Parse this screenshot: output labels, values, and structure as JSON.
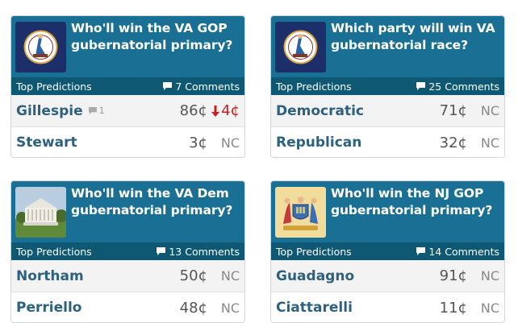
{
  "labels": {
    "top_predictions": "Top Predictions",
    "comments_suffix": "Comments"
  },
  "colors": {
    "header": "#1a7094",
    "subbar": "#0e5874",
    "candidate": "#2c6180",
    "down": "#d21b1b"
  },
  "cards": [
    {
      "title": "Who'll win the VA GOP gubernatorial primary?",
      "image": "virginia-flag-icon",
      "top_predictions": "Top Predictions",
      "comments": "7 Comments",
      "rows": [
        {
          "name": "Gillespie",
          "comment_count": "1",
          "price": "86¢",
          "change": "4¢",
          "direction": "down"
        },
        {
          "name": "Stewart",
          "price": "3¢",
          "change": "NC"
        }
      ]
    },
    {
      "title": "Which party will win VA gubernatorial race?",
      "image": "virginia-flag-icon",
      "top_predictions": "Top Predictions",
      "comments": "25 Comments",
      "rows": [
        {
          "name": "Democratic",
          "price": "71¢",
          "change": "NC"
        },
        {
          "name": "Republican",
          "price": "32¢",
          "change": "NC"
        }
      ]
    },
    {
      "title": "Who'll win the VA Dem gubernatorial primary?",
      "image": "capitol-building-photo",
      "top_predictions": "Top Predictions",
      "comments": "13 Comments",
      "rows": [
        {
          "name": "Northam",
          "price": "50¢",
          "change": "NC"
        },
        {
          "name": "Perriello",
          "price": "48¢",
          "change": "NC"
        }
      ]
    },
    {
      "title": "Who'll win the NJ GOP gubernatorial primary?",
      "image": "new-jersey-seal-icon",
      "top_predictions": "Top Predictions",
      "comments": "14 Comments",
      "rows": [
        {
          "name": "Guadagno",
          "price": "91¢",
          "change": "NC"
        },
        {
          "name": "Ciattarelli",
          "price": "11¢",
          "change": "NC"
        }
      ]
    }
  ]
}
